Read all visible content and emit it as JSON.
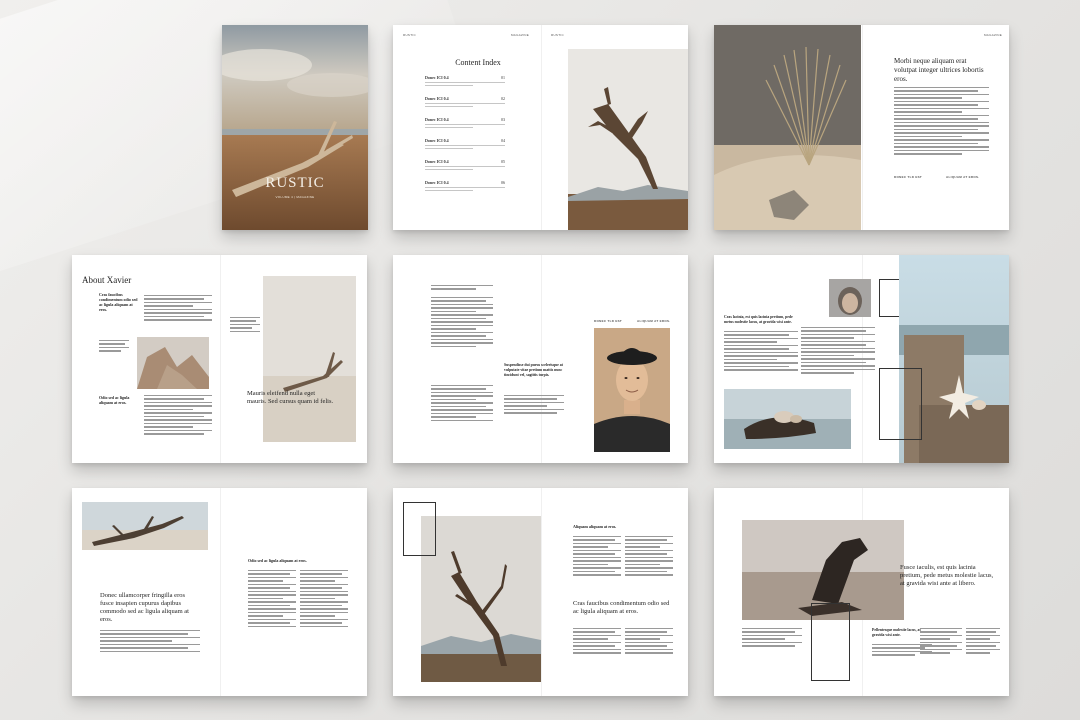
{
  "cover": {
    "title": "RUSTIC",
    "subtitle": "VOLUME 4 | MAGAZINE"
  },
  "spread_index": {
    "heading": "Content Index",
    "items": [
      {
        "label": "Donec ICI 0.4",
        "page": "01"
      },
      {
        "label": "Donec ICI 0.4",
        "page": "02"
      },
      {
        "label": "Donec ICI 0.4",
        "page": "03"
      },
      {
        "label": "Donec ICI 0.4",
        "page": "04"
      },
      {
        "label": "Donec ICI 0.4",
        "page": "05"
      },
      {
        "label": "Donec ICI 0.4",
        "page": "06"
      }
    ]
  },
  "spread_palm": {
    "heading": "Morbi neque aliquam erat volutpat integer ultrices lobortis eros.",
    "caption_left": "DONEC TLD EST",
    "caption_right": "ALIQUAM AT EROS."
  },
  "spread_about": {
    "heading": "About Xavier",
    "pullquote_1": "Cras faucibus condimentum odio sed ac ligula aliquam at eros.",
    "pullquote_2": "Odio sed ac ligula aliquam at eros.",
    "quote": "Mauris eleifend nulla eget mauris. Sed cursus quam id felis."
  },
  "spread_portrait": {
    "caption_left": "DONEC TLD EST",
    "caption_right": "ALIQUAM AT EROS.",
    "quote": "Suspendisse dui purus scelerisque at vulputate vitae pretium mattis nunc tincidunt vel, sagittis turpis."
  },
  "spread_shells": {
    "lead": "Cras lacinia, est quis lacinia pretium, pede metus molestie lacus, at gravida wisi ante."
  },
  "spread_branch": {
    "pullquote": "Odio sed ac ligula aliquam at eros.",
    "heading": "Donec ullamcorper fringilla eros fusce insapien cupurus dapibus commodo sed ac ligula aliquam at eros."
  },
  "spread_tree": {
    "pullquote": "Aliquam aliquam at eros.",
    "heading": "Cras faucibus condimentum odio sed ac ligula aliquam at eros."
  },
  "spread_wood": {
    "heading": "Fusce iaculis, est quis lacinia pretium, pede metus molestie lacus, at gravida wisi ante at libero.",
    "pullquote": "Pellentesque molestie lacus, at gravida wisi ante."
  }
}
